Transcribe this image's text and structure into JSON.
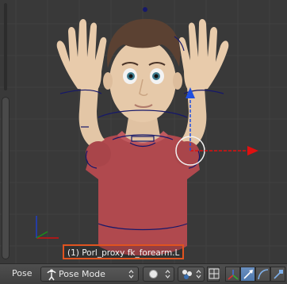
{
  "viewport": {
    "object_info": "(1) Porl_proxy fk_forearm.L"
  },
  "header": {
    "menu_pose": "Pose",
    "mode_select": {
      "value": "Pose Mode",
      "icon": "pose-mode-icon"
    },
    "shading": {
      "icon": "solid-sphere-icon"
    },
    "pivot": {
      "icon": "pivot-point-icon"
    },
    "buttons": [
      {
        "name": "manipulator-toggle",
        "icon": "axes-manipulator-icon",
        "active": false
      },
      {
        "name": "translate-manipulator",
        "icon": "arrow-icon",
        "active": true
      },
      {
        "name": "rotate-manipulator",
        "icon": "arc-icon",
        "active": false
      },
      {
        "name": "scale-manipulator",
        "icon": "scale-icon",
        "active": false
      }
    ]
  },
  "colors": {
    "accent": "#e0531f",
    "viewport_bg": "#393939",
    "shirt": "#b0494e",
    "skin": "#e3c6a6",
    "hair": "#5b4132",
    "bone_wire": "#16186a",
    "axis_x": "#e01010",
    "axis_y": "#1f4fe0"
  }
}
